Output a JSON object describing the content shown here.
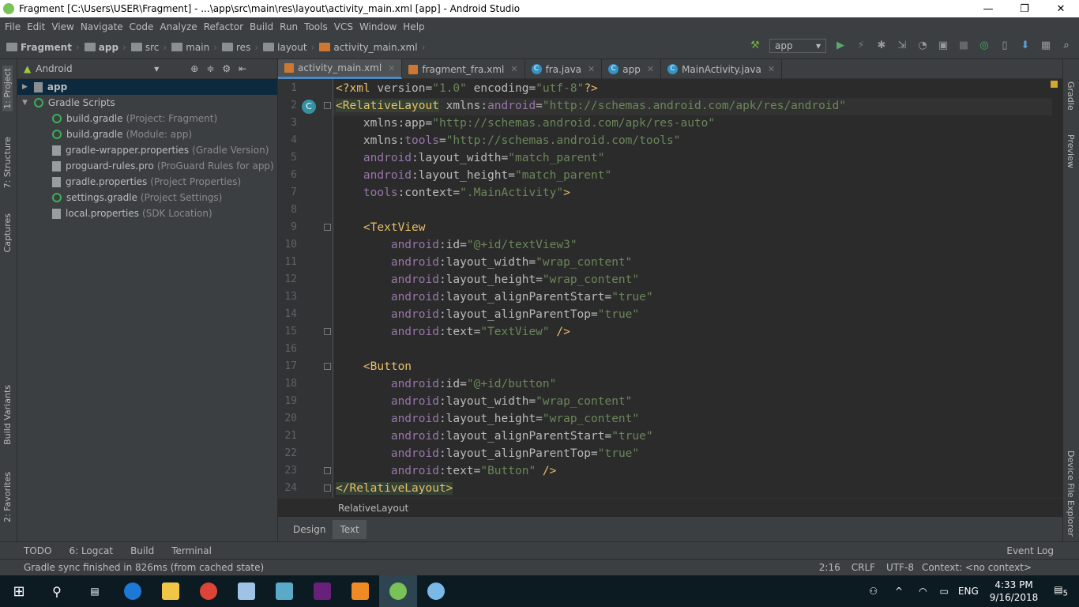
{
  "window": {
    "title": "Fragment [C:\\Users\\USER\\Fragment] - ...\\app\\src\\main\\res\\layout\\activity_main.xml [app] - Android Studio",
    "minimize": "—",
    "restore": "❐",
    "close": "✕"
  },
  "menu": [
    "File",
    "Edit",
    "View",
    "Navigate",
    "Code",
    "Analyze",
    "Refactor",
    "Build",
    "Run",
    "Tools",
    "VCS",
    "Window",
    "Help"
  ],
  "breadcrumb": [
    "Fragment",
    "app",
    "src",
    "main",
    "res",
    "layout",
    "activity_main.xml"
  ],
  "toolbar": {
    "run_config": "app"
  },
  "left_strip": [
    "1: Project",
    "7: Structure",
    "Captures",
    "Build Variants",
    "2: Favorites"
  ],
  "right_strip": [
    "Gradle",
    "Preview",
    "Device File Explorer"
  ],
  "project": {
    "view": "Android",
    "tree": [
      {
        "label": "app",
        "hint": "",
        "level": 0,
        "icon": "folder"
      },
      {
        "label": "Gradle Scripts",
        "hint": "",
        "level": 0,
        "icon": "gradle"
      },
      {
        "label": "build.gradle",
        "hint": "(Project: Fragment)",
        "level": 1,
        "icon": "gradle"
      },
      {
        "label": "build.gradle",
        "hint": "(Module: app)",
        "level": 1,
        "icon": "gradle"
      },
      {
        "label": "gradle-wrapper.properties",
        "hint": "(Gradle Version)",
        "level": 1,
        "icon": "file"
      },
      {
        "label": "proguard-rules.pro",
        "hint": "(ProGuard Rules for app)",
        "level": 1,
        "icon": "file"
      },
      {
        "label": "gradle.properties",
        "hint": "(Project Properties)",
        "level": 1,
        "icon": "file"
      },
      {
        "label": "settings.gradle",
        "hint": "(Project Settings)",
        "level": 1,
        "icon": "gradle"
      },
      {
        "label": "local.properties",
        "hint": "(SDK Location)",
        "level": 1,
        "icon": "file"
      }
    ]
  },
  "tabs": [
    {
      "label": "activity_main.xml",
      "icon": "xml",
      "active": true
    },
    {
      "label": "fragment_fra.xml",
      "icon": "xml",
      "active": false
    },
    {
      "label": "fra.java",
      "icon": "class",
      "active": false
    },
    {
      "label": "app",
      "icon": "class",
      "active": false
    },
    {
      "label": "MainActivity.java",
      "icon": "class",
      "active": false
    }
  ],
  "code": [
    [
      [
        "pi",
        "<?xml "
      ],
      [
        "att",
        "version"
      ],
      [
        "att",
        "="
      ],
      [
        "str",
        "\"1.0\""
      ],
      [
        "att",
        " encoding"
      ],
      [
        "att",
        "="
      ],
      [
        "str",
        "\"utf-8\""
      ],
      [
        "pi",
        "?>"
      ]
    ],
    [
      [
        "tag hl",
        "<RelativeLayout"
      ],
      [
        "att",
        " xmlns:"
      ],
      [
        "ns",
        "android"
      ],
      [
        "att",
        "="
      ],
      [
        "str",
        "\"http://schemas.android.com/apk/res/android\""
      ]
    ],
    [
      [
        "att",
        "    xmlns:app="
      ],
      [
        "str",
        "\"http://schemas.android.com/apk/res-auto\""
      ]
    ],
    [
      [
        "att",
        "    xmlns:"
      ],
      [
        "ns",
        "tools"
      ],
      [
        "att",
        "="
      ],
      [
        "str",
        "\"http://schemas.android.com/tools\""
      ]
    ],
    [
      [
        "ns",
        "    android"
      ],
      [
        "att",
        ":layout_width="
      ],
      [
        "str",
        "\"match_parent\""
      ]
    ],
    [
      [
        "ns",
        "    android"
      ],
      [
        "att",
        ":layout_height="
      ],
      [
        "str",
        "\"match_parent\""
      ]
    ],
    [
      [
        "ns",
        "    tools"
      ],
      [
        "att",
        ":context="
      ],
      [
        "str",
        "\".MainActivity\""
      ],
      [
        "tag",
        ">"
      ]
    ],
    [],
    [
      [
        "tag",
        "    <TextView"
      ]
    ],
    [
      [
        "ns",
        "        android"
      ],
      [
        "att",
        ":id="
      ],
      [
        "str",
        "\"@+id/textView3\""
      ]
    ],
    [
      [
        "ns",
        "        android"
      ],
      [
        "att",
        ":layout_width="
      ],
      [
        "str",
        "\"wrap_content\""
      ]
    ],
    [
      [
        "ns",
        "        android"
      ],
      [
        "att",
        ":layout_height="
      ],
      [
        "str",
        "\"wrap_content\""
      ]
    ],
    [
      [
        "ns",
        "        android"
      ],
      [
        "att",
        ":layout_alignParentStart="
      ],
      [
        "str",
        "\"true\""
      ]
    ],
    [
      [
        "ns",
        "        android"
      ],
      [
        "att",
        ":layout_alignParentTop="
      ],
      [
        "str",
        "\"true\""
      ]
    ],
    [
      [
        "ns",
        "        android"
      ],
      [
        "att",
        ":text="
      ],
      [
        "str",
        "\"TextView\""
      ],
      [
        "tag",
        " />"
      ]
    ],
    [],
    [
      [
        "tag",
        "    <Button"
      ]
    ],
    [
      [
        "ns",
        "        android"
      ],
      [
        "att",
        ":id="
      ],
      [
        "str",
        "\"@+id/button\""
      ]
    ],
    [
      [
        "ns",
        "        android"
      ],
      [
        "att",
        ":layout_width="
      ],
      [
        "str",
        "\"wrap_content\""
      ]
    ],
    [
      [
        "ns",
        "        android"
      ],
      [
        "att",
        ":layout_height="
      ],
      [
        "str",
        "\"wrap_content\""
      ]
    ],
    [
      [
        "ns",
        "        android"
      ],
      [
        "att",
        ":layout_alignParentStart="
      ],
      [
        "str",
        "\"true\""
      ]
    ],
    [
      [
        "ns",
        "        android"
      ],
      [
        "att",
        ":layout_alignParentTop="
      ],
      [
        "str",
        "\"true\""
      ]
    ],
    [
      [
        "ns",
        "        android"
      ],
      [
        "att",
        ":text="
      ],
      [
        "str",
        "\"Button\""
      ],
      [
        "tag",
        " />"
      ]
    ],
    [
      [
        "tag hl",
        "</RelativeLayout>"
      ]
    ]
  ],
  "editor_breadcrumb": "RelativeLayout",
  "design_tabs": [
    "Design",
    "Text"
  ],
  "bottom_tools": [
    "TODO",
    "6: Logcat",
    "Build",
    "Terminal"
  ],
  "event_log": "Event Log",
  "status": {
    "message": "Gradle sync finished in 826ms (from cached state)",
    "position": "2:16",
    "line_sep": "CRLF",
    "encoding": "UTF-8",
    "context": "Context: <no context>"
  },
  "taskbar": {
    "time": "4:33 PM",
    "date": "9/16/2018",
    "lang": "ENG",
    "notifications": "5"
  },
  "colors": {
    "accent": "#4a88c7",
    "editor_bg": "#2b2b2b",
    "tag": "#e8bf6a",
    "string": "#6a8759",
    "namespace": "#9876aa"
  }
}
